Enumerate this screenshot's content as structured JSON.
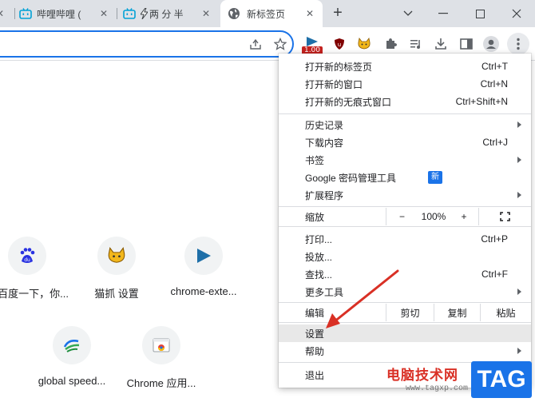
{
  "tabs": [
    {
      "title": "哔哩哔哩 (",
      "icon": "bilibili-icon"
    },
    {
      "title": "两 分 半",
      "icon": "bilibili-icon"
    },
    {
      "title": "新标签页",
      "icon": "globe-icon",
      "active": true
    }
  ],
  "window_controls": {
    "new_tab": "+",
    "minimize": "—",
    "maximize": "☐",
    "close": "✕"
  },
  "extension_badge": "1.00",
  "shortcuts": [
    {
      "label": "百度一下，你...",
      "icon": "baidu-icon"
    },
    {
      "label": "猫抓 设置",
      "icon": "cat-icon"
    },
    {
      "label": "chrome-exte...",
      "icon": "play-icon"
    },
    {
      "label": "global speed...",
      "icon": "global-speed-icon"
    },
    {
      "label": "Chrome 应用...",
      "icon": "chrome-icon"
    }
  ],
  "menu": {
    "new_tab": {
      "label": "打开新的标签页",
      "shortcut": "Ctrl+T"
    },
    "new_window": {
      "label": "打开新的窗口",
      "shortcut": "Ctrl+N"
    },
    "incognito": {
      "label": "打开新的无痕式窗口",
      "shortcut": "Ctrl+Shift+N"
    },
    "history": {
      "label": "历史记录"
    },
    "downloads": {
      "label": "下载内容",
      "shortcut": "Ctrl+J"
    },
    "bookmarks": {
      "label": "书签"
    },
    "passwords": {
      "label": "Google 密码管理工具",
      "badge": "新"
    },
    "extensions": {
      "label": "扩展程序"
    },
    "zoom": {
      "label": "缩放",
      "minus": "−",
      "value": "100%",
      "plus": "+"
    },
    "print": {
      "label": "打印...",
      "shortcut": "Ctrl+P"
    },
    "cast": {
      "label": "投放..."
    },
    "find": {
      "label": "查找...",
      "shortcut": "Ctrl+F"
    },
    "more_tools": {
      "label": "更多工具"
    },
    "edit": {
      "label": "编辑",
      "cut": "剪切",
      "copy": "复制",
      "paste": "粘贴"
    },
    "settings": {
      "label": "设置"
    },
    "help": {
      "label": "帮助"
    },
    "exit": {
      "label": "退出"
    }
  },
  "watermark": {
    "site_name": "电脑技术网",
    "url": "www.tagxp.com",
    "logo": "TAG"
  },
  "colors": {
    "accent": "#1a73e8",
    "annotation_arrow": "#d93025",
    "menu_highlight": "#e8e8e8"
  }
}
